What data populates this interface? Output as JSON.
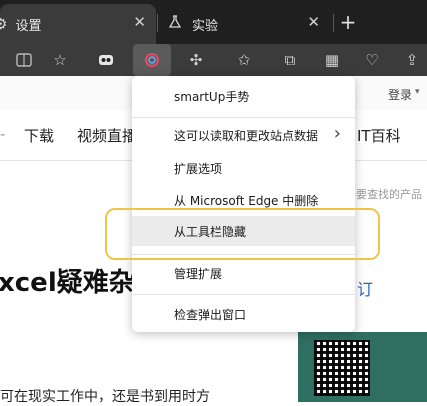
{
  "tabs": [
    {
      "label": "设置",
      "close": "✕"
    },
    {
      "label": "实验",
      "close": "✕"
    }
  ],
  "new_tab": "+",
  "page": {
    "login": "登录",
    "nav": [
      "下载",
      "视频直播",
      "IT百科"
    ],
    "search_placeholder": "要查找的产品",
    "headline": "xcel疑难杂",
    "body_text": "可在现实工作中，还是书到用时方",
    "side_link": "订"
  },
  "menu": {
    "items": [
      {
        "label": "smartUp手势"
      },
      {
        "label": "这可以读取和更改站点数据",
        "chevron": "›"
      },
      {
        "label": "扩展选项"
      },
      {
        "label": "从 Microsoft Edge 中删除"
      },
      {
        "label": "从工具栏隐藏"
      },
      {
        "label": "管理扩展"
      },
      {
        "label": "检查弹出窗口"
      }
    ]
  },
  "icons": [
    "settings-icon",
    "flask-icon",
    "split-screen-icon",
    "favorite-add-icon",
    "extension-eyes-icon",
    "smartup-icon",
    "extensions-icon",
    "favorites-icon",
    "collections-icon",
    "apps-icon",
    "performance-icon",
    "share-icon",
    "qr-code-icon"
  ]
}
